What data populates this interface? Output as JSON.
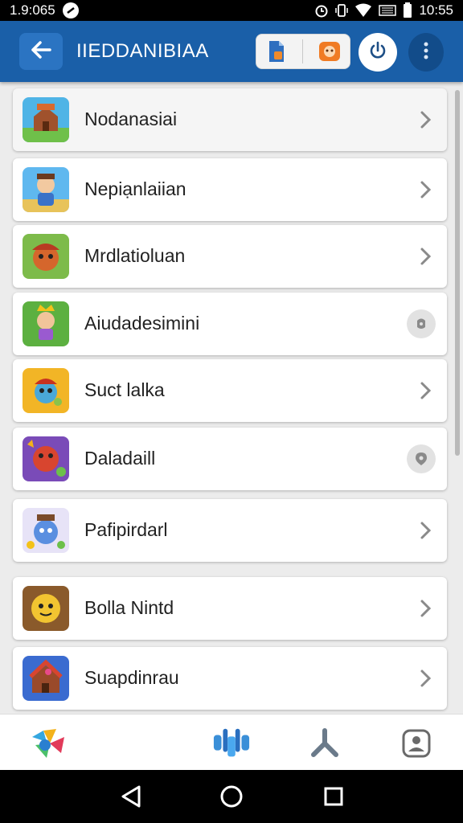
{
  "status_bar": {
    "time_left": "1.9:065",
    "time_right": "10:55",
    "icons": [
      "alarm-icon",
      "vibrate-icon",
      "wifi-icon",
      "data-icon",
      "battery-icon"
    ]
  },
  "app_bar": {
    "title": "IIEDDANIBIAA",
    "back_icon": "arrow-left-icon",
    "actions": [
      "file-icon",
      "game-icon",
      "power-icon",
      "more-vert-icon"
    ]
  },
  "games": [
    {
      "label": "Nodanasiai",
      "trailing": "chevron",
      "accent": "#b5482a"
    },
    {
      "label": "Nepiạnlaiian",
      "trailing": "chevron",
      "accent": "#3b8fd6"
    },
    {
      "label": "Mrdlatioluan",
      "trailing": "chevron",
      "accent": "#c9562e"
    },
    {
      "label": "Aiudadesimini",
      "trailing": "badge",
      "accent": "#5db33f"
    },
    {
      "label": "Suct lalka",
      "trailing": "chevron",
      "accent": "#f0b52a"
    },
    {
      "label": "Daladaill",
      "trailing": "badge",
      "accent": "#d8452f"
    },
    {
      "label": "Pafipirdarl",
      "trailing": "chevron",
      "accent": "#5a8fe0"
    },
    {
      "label": "Bolla Nintd",
      "trailing": "chevron",
      "accent": "#f2c431"
    },
    {
      "label": "Suapdinrau",
      "trailing": "chevron",
      "accent": "#3a6bd0"
    }
  ],
  "bottom_nav": [
    "app-logo-icon",
    "controller-icon",
    "tools-icon",
    "profile-icon"
  ],
  "system_nav": [
    "back-triangle-icon",
    "home-circle-icon",
    "recents-square-icon"
  ],
  "colors": {
    "app_bar": "#1a5fa8",
    "back_button": "#2b74c2",
    "list_background": "#ececec"
  }
}
